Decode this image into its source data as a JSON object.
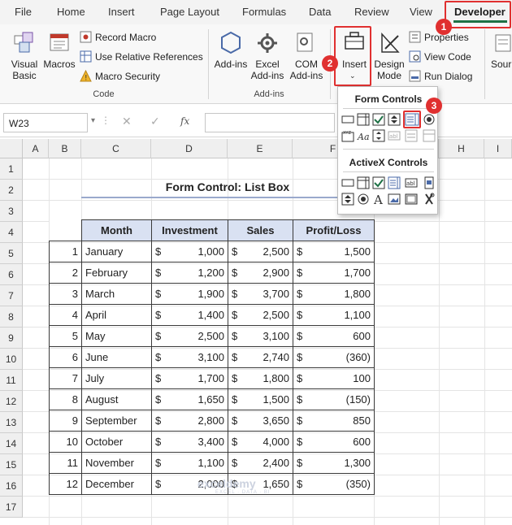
{
  "tabs": [
    "File",
    "Home",
    "Insert",
    "Page Layout",
    "Formulas",
    "Data",
    "Review",
    "View",
    "Developer"
  ],
  "ribbon": {
    "code": {
      "visual_basic": "Visual Basic",
      "macros": "Macros",
      "record_macro": "Record Macro",
      "use_relative": "Use Relative References",
      "macro_security": "Macro Security",
      "group": "Code"
    },
    "addins": {
      "add_ins": "Add-ins",
      "excel_addins": "Excel Add-ins",
      "com_addins": "COM Add-ins",
      "group": "Add-ins"
    },
    "controls": {
      "insert": "Insert",
      "design_mode": "Design Mode",
      "properties": "Properties",
      "view_code": "View Code",
      "run_dialog": "Run Dialog"
    },
    "source_partial": "Sour"
  },
  "callouts": [
    "1",
    "2",
    "3"
  ],
  "formula_bar": {
    "name_box": "W23",
    "fx": "fx"
  },
  "columns": [
    "A",
    "B",
    "C",
    "D",
    "E",
    "F",
    "H",
    "I"
  ],
  "rows": [
    "1",
    "2",
    "3",
    "4",
    "5",
    "6",
    "7",
    "8",
    "9",
    "10",
    "11",
    "12",
    "13",
    "14",
    "15",
    "16",
    "17"
  ],
  "sheet_title": "Form Control: List Box",
  "dropdown": {
    "form_controls": "Form Controls",
    "activex_controls": "ActiveX Controls"
  },
  "table": {
    "headers": [
      "Month",
      "Investment",
      "Sales",
      "Profit/Loss"
    ],
    "currency": "$",
    "rows": [
      {
        "no": "1",
        "month": "January",
        "inv": "1,000",
        "sales": "2,500",
        "pl": "1,500"
      },
      {
        "no": "2",
        "month": "February",
        "inv": "1,200",
        "sales": "2,900",
        "pl": "1,700"
      },
      {
        "no": "3",
        "month": "March",
        "inv": "1,900",
        "sales": "3,700",
        "pl": "1,800"
      },
      {
        "no": "4",
        "month": "April",
        "inv": "1,400",
        "sales": "2,500",
        "pl": "1,100"
      },
      {
        "no": "5",
        "month": "May",
        "inv": "2,500",
        "sales": "3,100",
        "pl": "600"
      },
      {
        "no": "6",
        "month": "June",
        "inv": "3,100",
        "sales": "2,740",
        "pl": "(360)"
      },
      {
        "no": "7",
        "month": "July",
        "inv": "1,700",
        "sales": "1,800",
        "pl": "100"
      },
      {
        "no": "8",
        "month": "August",
        "inv": "1,650",
        "sales": "1,500",
        "pl": "(150)"
      },
      {
        "no": "9",
        "month": "September",
        "inv": "2,800",
        "sales": "3,650",
        "pl": "850"
      },
      {
        "no": "10",
        "month": "October",
        "inv": "3,400",
        "sales": "4,000",
        "pl": "600"
      },
      {
        "no": "11",
        "month": "November",
        "inv": "1,100",
        "sales": "2,400",
        "pl": "1,300"
      },
      {
        "no": "12",
        "month": "December",
        "inv": "2,000",
        "sales": "1,650",
        "pl": "(350)"
      }
    ]
  },
  "watermark": {
    "name": "exceldemy",
    "tagline": "EXCEL · DATA · BI"
  },
  "colors": {
    "accent": "#1e7145",
    "callout": "#e03030",
    "header_fill": "#d9e1f2"
  }
}
